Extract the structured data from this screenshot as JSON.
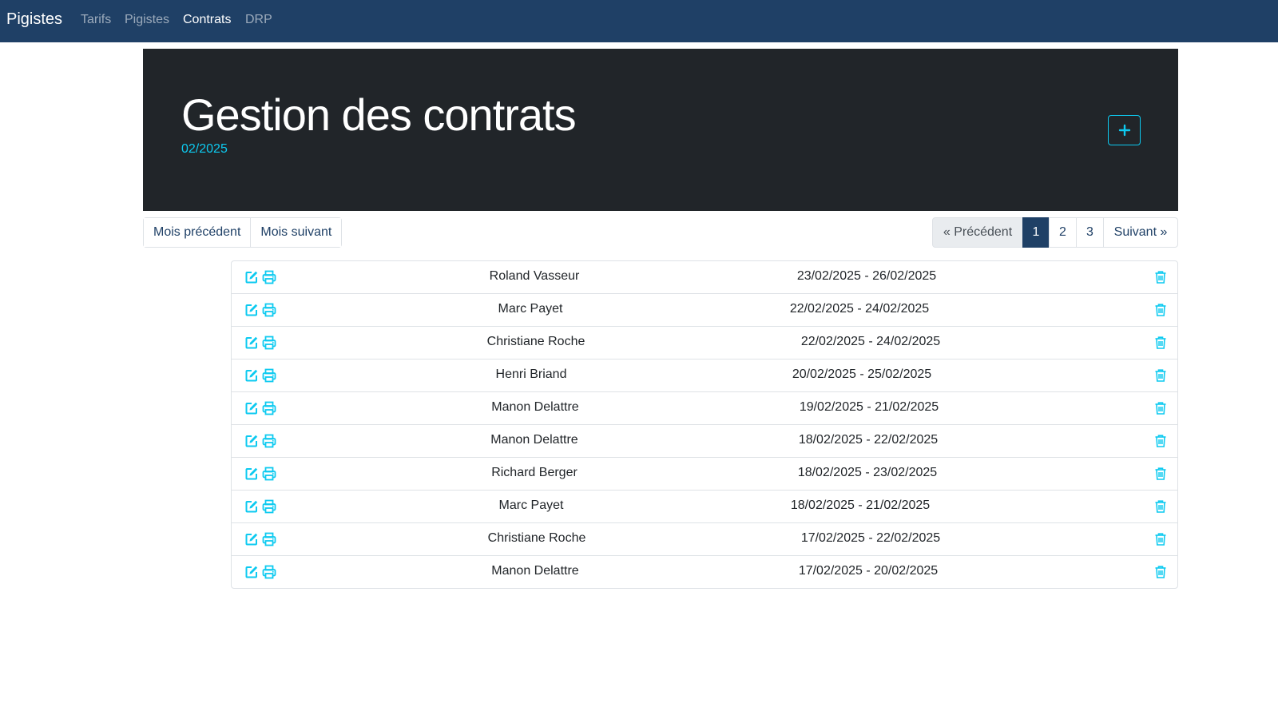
{
  "navbar": {
    "brand": "Pigistes",
    "items": [
      {
        "label": "Tarifs",
        "active": false
      },
      {
        "label": "Pigistes",
        "active": false
      },
      {
        "label": "Contrats",
        "active": true
      },
      {
        "label": "DRP",
        "active": false
      }
    ]
  },
  "header": {
    "title": "Gestion des contrats",
    "period": "02/2025",
    "add_icon": "plus-icon"
  },
  "month_nav": {
    "previous_label": "Mois précédent",
    "next_label": "Mois suivant"
  },
  "pagination": {
    "previous_label": "« Précédent",
    "pages": [
      "1",
      "2",
      "3"
    ],
    "current_page": "1",
    "next_label": "Suivant »"
  },
  "contracts": [
    {
      "name": "Roland Vasseur",
      "period": "23/02/2025 - 26/02/2025"
    },
    {
      "name": "Marc Payet",
      "period": "22/02/2025 - 24/02/2025"
    },
    {
      "name": "Christiane Roche",
      "period": "22/02/2025 - 24/02/2025"
    },
    {
      "name": "Henri Briand",
      "period": "20/02/2025 - 25/02/2025"
    },
    {
      "name": "Manon Delattre",
      "period": "19/02/2025 - 21/02/2025"
    },
    {
      "name": "Manon Delattre",
      "period": "18/02/2025 - 22/02/2025"
    },
    {
      "name": "Richard Berger",
      "period": "18/02/2025 - 23/02/2025"
    },
    {
      "name": "Marc Payet",
      "period": "18/02/2025 - 21/02/2025"
    },
    {
      "name": "Christiane Roche",
      "period": "17/02/2025 - 22/02/2025"
    },
    {
      "name": "Manon Delattre",
      "period": "17/02/2025 - 20/02/2025"
    }
  ],
  "row_icons": {
    "edit": "edit-icon",
    "print": "print-icon",
    "delete": "trash-icon"
  },
  "colors": {
    "navbar": "#1f4066",
    "jumbotron": "#212529",
    "accent": "#0dcaf0"
  }
}
